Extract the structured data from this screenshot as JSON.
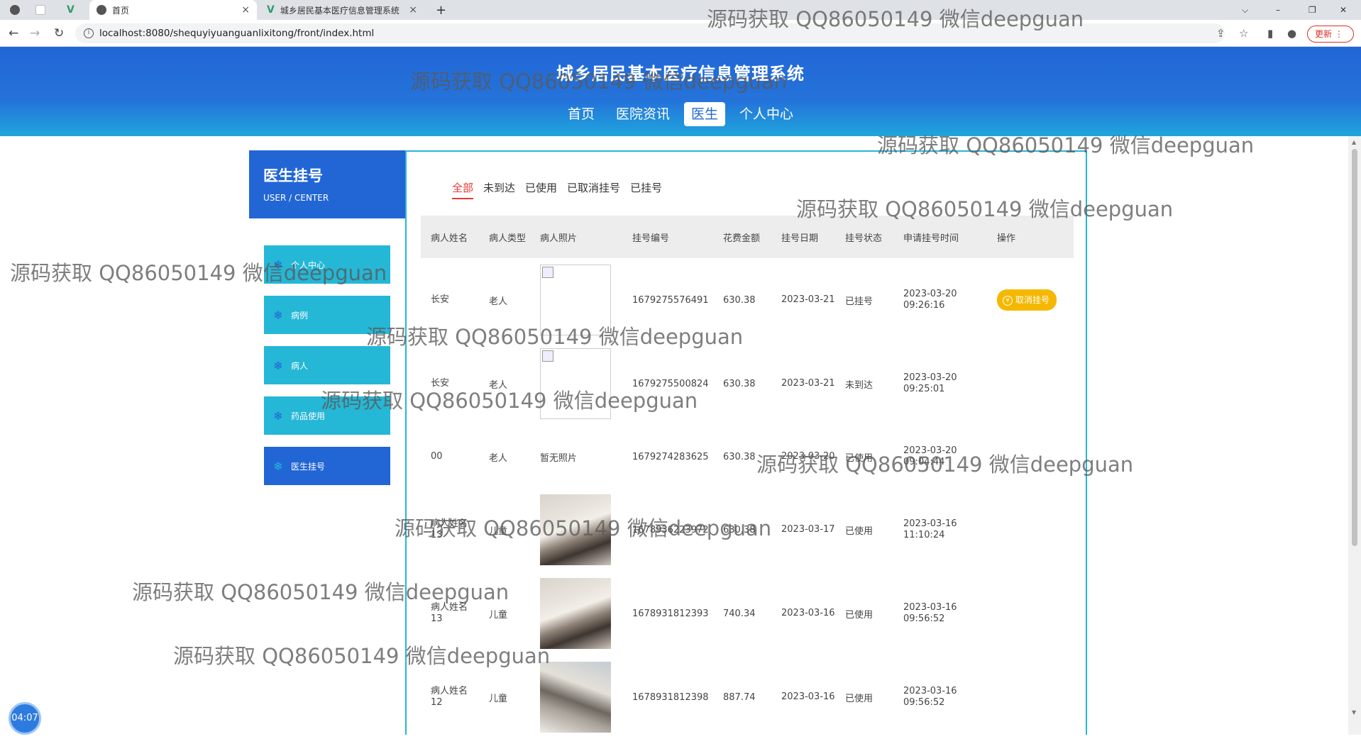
{
  "browser": {
    "tabs": [
      {
        "label": "首页",
        "close": "×"
      },
      {
        "label": "城乡居民基本医疗信息管理系统",
        "close": "×"
      }
    ],
    "new_tab": "+",
    "url": "localhost:8080/shequyiyuanguanlixitong/front/index.html",
    "update_label": "更新",
    "window_controls": [
      "⌵",
      "–",
      "❐",
      "✕"
    ]
  },
  "site": {
    "title": "城乡居民基本医疗信息管理系统",
    "nav": [
      {
        "label": "首页",
        "active": false
      },
      {
        "label": "医院资讯",
        "active": false
      },
      {
        "label": "医生",
        "active": true
      },
      {
        "label": "个人中心",
        "active": false
      }
    ]
  },
  "sidebar": {
    "title": "医生挂号",
    "subtitle": "USER / CENTER",
    "items": [
      {
        "label": "个人中心",
        "icon": "snowflake-icon"
      },
      {
        "label": "病例",
        "icon": "snowflake-icon"
      },
      {
        "label": "病人",
        "icon": "snowflake-icon"
      },
      {
        "label": "药品使用",
        "icon": "snowflake-icon"
      },
      {
        "label": "医生挂号",
        "icon": "snowflake-icon",
        "active": true
      }
    ]
  },
  "filters": [
    "全部",
    "未到达",
    "已使用",
    "已取消挂号",
    "已挂号"
  ],
  "table": {
    "headers": [
      "病人姓名",
      "病人类型",
      "病人照片",
      "挂号编号",
      "花费金额",
      "挂号日期",
      "挂号状态",
      "申请挂号时间",
      "操作"
    ],
    "rows": [
      {
        "name": "长安",
        "type": "老人",
        "photo": "broken",
        "no": "1679275576491",
        "fee": "630.38",
        "date": "2023-03-21",
        "status": "已挂号",
        "time": "2023-03-20 09:26:16",
        "action": "取消挂号"
      },
      {
        "name": "长安",
        "type": "老人",
        "photo": "broken",
        "no": "1679275500824",
        "fee": "630.38",
        "date": "2023-03-21",
        "status": "未到达",
        "time": "2023-03-20 09:25:01",
        "action": ""
      },
      {
        "name": "00",
        "type": "老人",
        "photo": "none",
        "photo_text": "暂无照片",
        "no": "1679274283625",
        "fee": "630.38",
        "date": "2023-03-20",
        "status": "已使用",
        "time": "2023-03-20 09:04:44",
        "action": ""
      },
      {
        "name": "病人姓名13",
        "type": "儿童",
        "photo": "img",
        "no": "1678936223972",
        "fee": "630.38",
        "date": "2023-03-17",
        "status": "已使用",
        "time": "2023-03-16 11:10:24",
        "action": ""
      },
      {
        "name": "病人姓名13",
        "type": "儿童",
        "photo": "img",
        "no": "1678931812393",
        "fee": "740.34",
        "date": "2023-03-16",
        "status": "已使用",
        "time": "2023-03-16 09:56:52",
        "action": ""
      },
      {
        "name": "病人姓名12",
        "type": "儿童",
        "photo": "img2",
        "no": "1678931812398",
        "fee": "887.74",
        "date": "2023-03-16",
        "status": "已使用",
        "time": "2023-03-16 09:56:52",
        "action": ""
      }
    ]
  },
  "watermark": "源码获取 QQ86050149 微信deepguan",
  "timer": "04:07",
  "colors": {
    "primary": "#2266d6",
    "cyan": "#25b7d6",
    "accent_red": "#e53935",
    "button_yellow": "#f5b800"
  }
}
